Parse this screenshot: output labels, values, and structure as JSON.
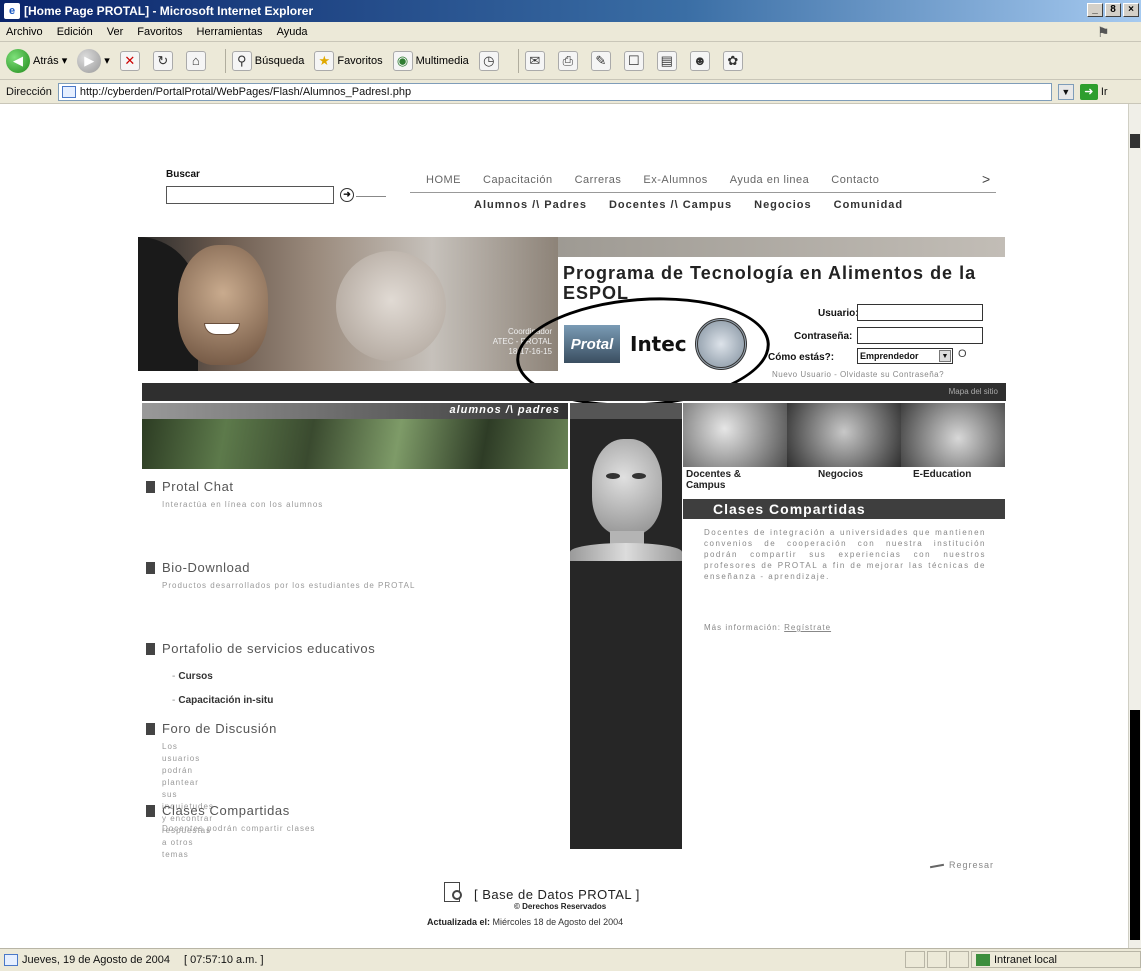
{
  "window": {
    "title": "[Home Page PROTAL] - Microsoft Internet Explorer",
    "controls": [
      "_",
      "8",
      "×"
    ]
  },
  "menu": [
    "Archivo",
    "Edición",
    "Ver",
    "Favoritos",
    "Herramientas",
    "Ayuda"
  ],
  "toolbar": {
    "back": "Atrás",
    "search": "Búsqueda",
    "favorites": "Favoritos",
    "media": "Multimedia"
  },
  "address": {
    "label": "Dirección",
    "url": "http://cyberden/PortalProtal/WebPages/Flash/Alumnos_PadresI.php",
    "go": "Ir"
  },
  "search": {
    "label": "Buscar",
    "value": "",
    "go_icon": "arrow-circle-icon"
  },
  "nav": {
    "top": [
      "HOME",
      "Capacitación",
      "Carreras",
      "Ex-Alumnos",
      "Ayuda en linea",
      "Contacto"
    ],
    "more": ">",
    "sub": [
      "Alumnos /\\ Padres",
      "Docentes /\\ Campus",
      "Negocios",
      "Comunidad"
    ]
  },
  "banner": {
    "caption": "Coordinador\nATEC - PROTAL\n18-17-16-15"
  },
  "program": {
    "title": "Programa de Tecnología en Alimentos de la ESPOL",
    "logos": [
      "Protal",
      "Intec"
    ]
  },
  "login": {
    "user_label": "Usuario:",
    "user_value": "",
    "pass_label": "Contraseña:",
    "pass_value": "",
    "como_label": "Cómo estás?:",
    "como_value": "Emprendedor",
    "go": "O",
    "links": "Nuevo Usuario - Olvidaste su Contraseña?"
  },
  "darkbar": {
    "mapa": "Mapa del sitio"
  },
  "left_banner": {
    "tag": "alumnos /\\ padres"
  },
  "sections": [
    {
      "title": "Protal Chat",
      "desc": "Interactúa en línea con los alumnos"
    },
    {
      "title": "Bio-Download",
      "desc": "Productos desarrollados por los estudiantes de PROTAL"
    },
    {
      "title": "Portafolio de servicios educativos",
      "desc": ""
    },
    {
      "title": "Foro de Discusión",
      "desc": "Los usuarios podrán plantear sus inquietudes y encontrar\nrespuestas a otros temas"
    },
    {
      "title": "Clases Compartidas",
      "desc": "Docentes podrán compartir clases"
    }
  ],
  "portfolio_items": [
    "Cursos",
    "Capacitación in-situ"
  ],
  "right": {
    "labels": [
      "Docentes & Campus",
      "Negocios",
      "E-Education"
    ],
    "clases_title": "Clases Compartidas",
    "clases_text": "Docentes de integración a universidades que mantienen convenios de cooperación con nuestra institución podrán compartir sus experiencias con nuestros profesores de PROTAL a fin de mejorar las técnicas de enseñanza - aprendizaje.",
    "clases_more": "Más información:",
    "clases_link": "Regístrate"
  },
  "regresar": "Regresar",
  "footer": {
    "db": "[ Base de Datos PROTAL ]",
    "rights": "© Derechos Reservados",
    "updated_label": "Actualizada el:",
    "updated_value": "Miércoles 18 de Agosto del 2004"
  },
  "status": {
    "date": "Jueves, 19 de Agosto de 2004",
    "time": "[ 07:57:10 a.m. ]",
    "zone": "Intranet local"
  },
  "colors": {
    "title_blue": "#0a246a",
    "chrome": "#ece9d8",
    "dark": "#2f2f2f"
  }
}
